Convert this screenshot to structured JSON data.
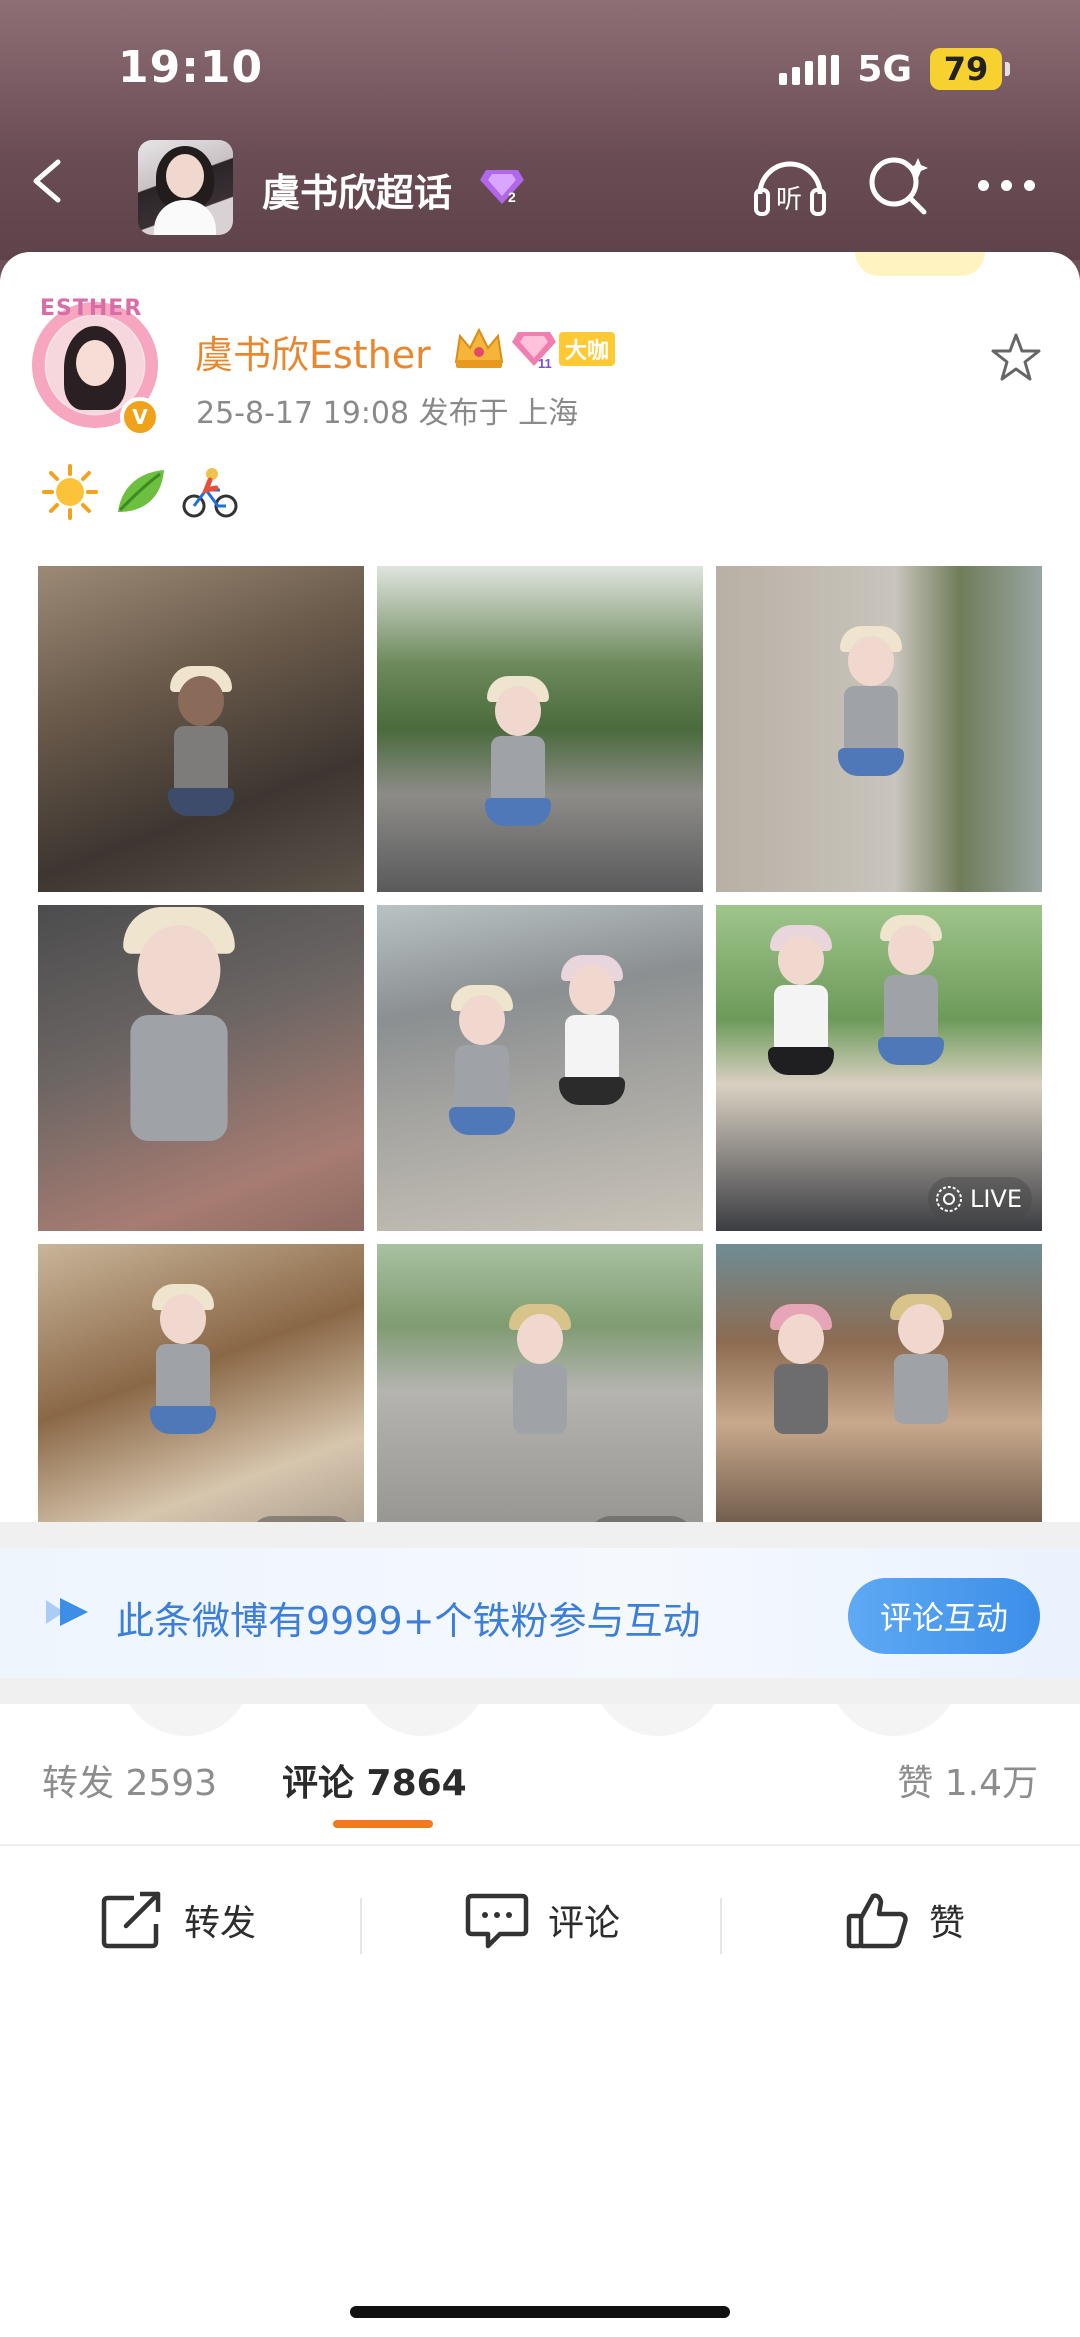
{
  "status": {
    "time": "19:10",
    "network": "5G",
    "battery": "79"
  },
  "header": {
    "title": "虞书欣超话",
    "listen_label": "听"
  },
  "post": {
    "author": "虞书欣Esther",
    "avatar_ring_text": "ESTHER",
    "vip_badge": "大咖",
    "verified_mark": "V",
    "meta": "25-8-17 19:08   发布于 上海",
    "photos": [
      {
        "live": false
      },
      {
        "live": false
      },
      {
        "live": false
      },
      {
        "live": false
      },
      {
        "live": false
      },
      {
        "live": true
      },
      {
        "live": true
      },
      {
        "live": true
      },
      {
        "live": false
      }
    ],
    "live_label": "LIVE"
  },
  "fans_bar": {
    "text": "此条微博有9999+个铁粉参与互动",
    "button": "评论互动"
  },
  "tabs": {
    "repost": "转发 2593",
    "comment": "评论 7864",
    "like": "赞 1.4万"
  },
  "actions": {
    "repost": "转发",
    "comment": "评论",
    "like": "赞"
  },
  "colors": {
    "accent": "#f07a1d",
    "name": "#e8872e",
    "link": "#3d7fd8"
  }
}
